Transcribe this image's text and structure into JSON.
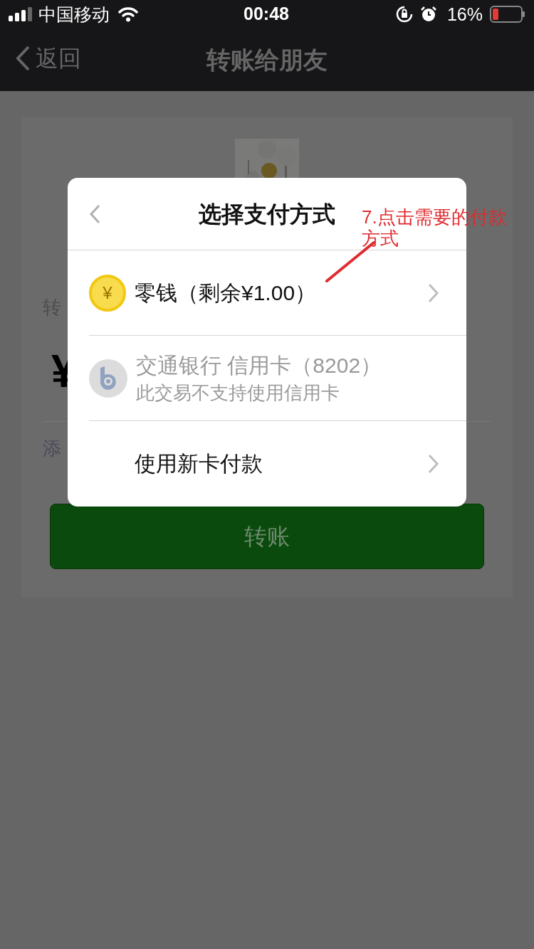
{
  "status_bar": {
    "carrier": "中国移动",
    "time": "00:48",
    "battery": "16%"
  },
  "nav_bar": {
    "back": "返回",
    "title": "转账给朋友"
  },
  "background": {
    "amount_label": "转",
    "currency": "¥",
    "note": "添",
    "button": "转账"
  },
  "dialog": {
    "title": "选择支付方式",
    "options": [
      {
        "kind": "balance",
        "icon_glyph": "¥",
        "label": "零钱（剩余¥1.00）",
        "disabled": false
      },
      {
        "kind": "bank",
        "label": "交通银行 信用卡（8202）",
        "note": "此交易不支持使用信用卡",
        "disabled": true
      },
      {
        "kind": "new_card",
        "label": "使用新卡付款",
        "disabled": false
      }
    ]
  },
  "annotation": {
    "lines": [
      "7.点击需要的付款",
      "方式"
    ]
  }
}
